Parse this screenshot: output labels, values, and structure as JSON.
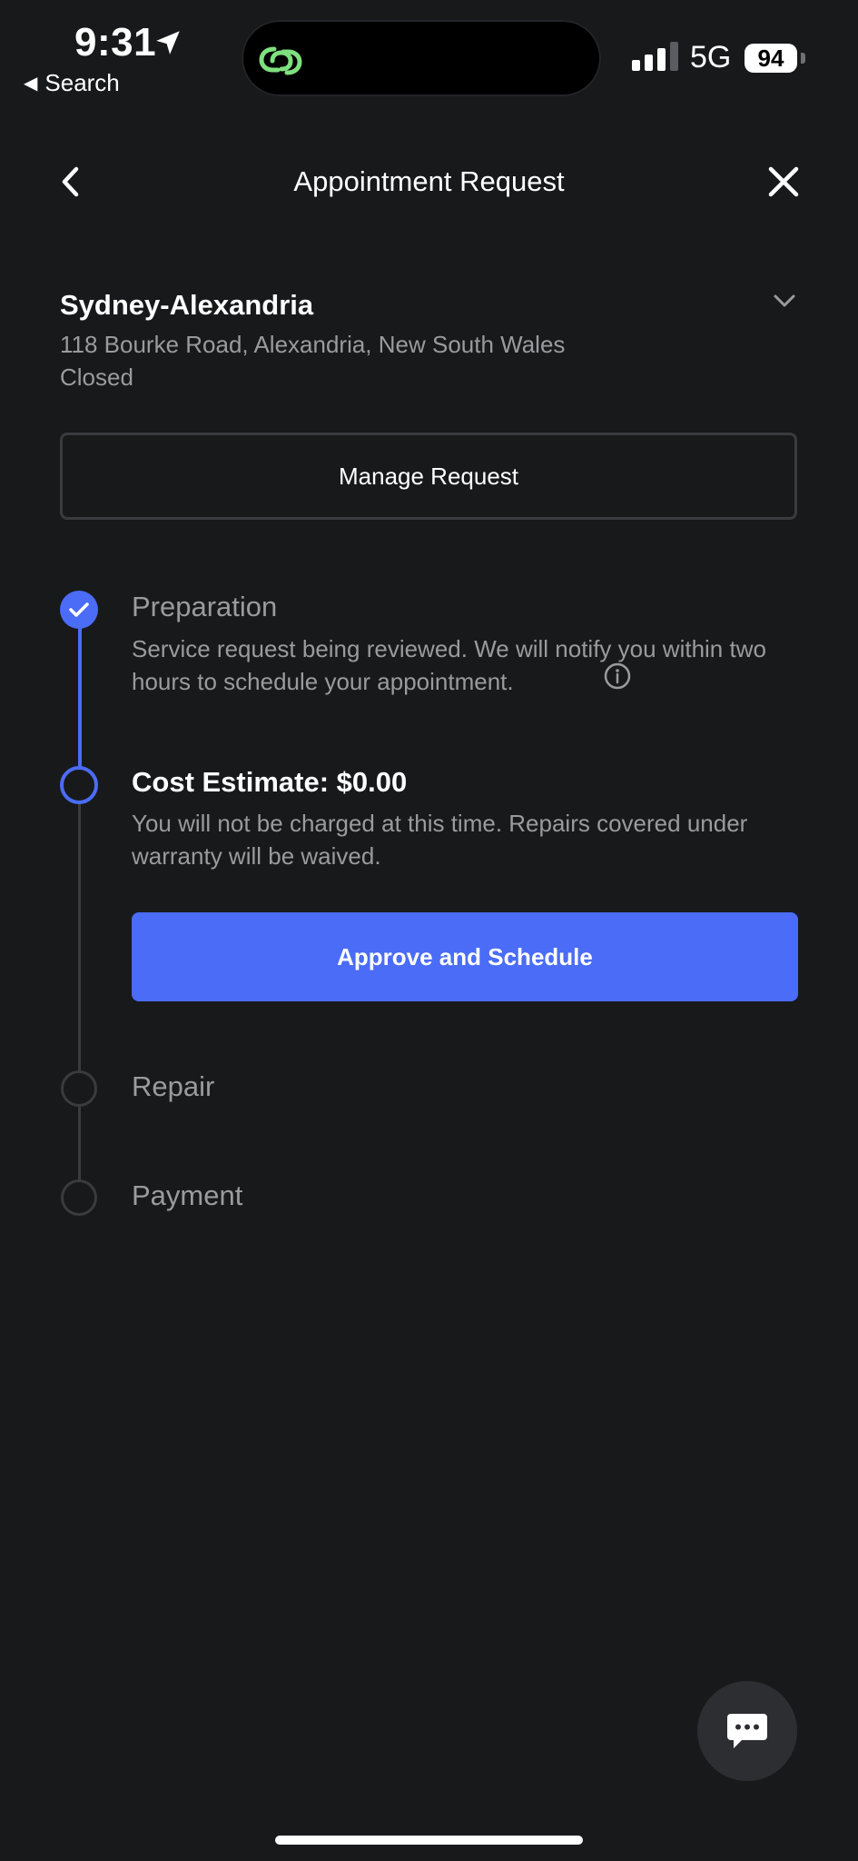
{
  "status_bar": {
    "time": "9:31",
    "back_app": "Search",
    "network": "5G",
    "battery": "94",
    "icons": [
      "location-arrow-icon",
      "link-icon",
      "signal-icon"
    ]
  },
  "header": {
    "title": "Appointment Request",
    "icons": [
      "chevron-left-icon",
      "close-icon"
    ]
  },
  "location": {
    "name": "Sydney-Alexandria",
    "address": "118 Bourke Road, Alexandria, New South Wales",
    "status": "Closed"
  },
  "manage_request_label": "Manage Request",
  "steps": [
    {
      "title": "Preparation",
      "description": "Service request being reviewed. We will notify you within two hours to schedule your appointment.",
      "state": "completed"
    },
    {
      "title": "Cost Estimate: $0.00",
      "description": "You will not be charged at this time. Repairs covered under warranty will be waived.",
      "state": "current",
      "action_label": "Approve and Schedule"
    },
    {
      "title": "Repair",
      "state": "pending"
    },
    {
      "title": "Payment",
      "state": "pending"
    }
  ],
  "colors": {
    "background": "#18191b",
    "accent": "#4a6cf7",
    "muted_text": "#9a9b9e",
    "link_icon": "#7ee07e"
  }
}
